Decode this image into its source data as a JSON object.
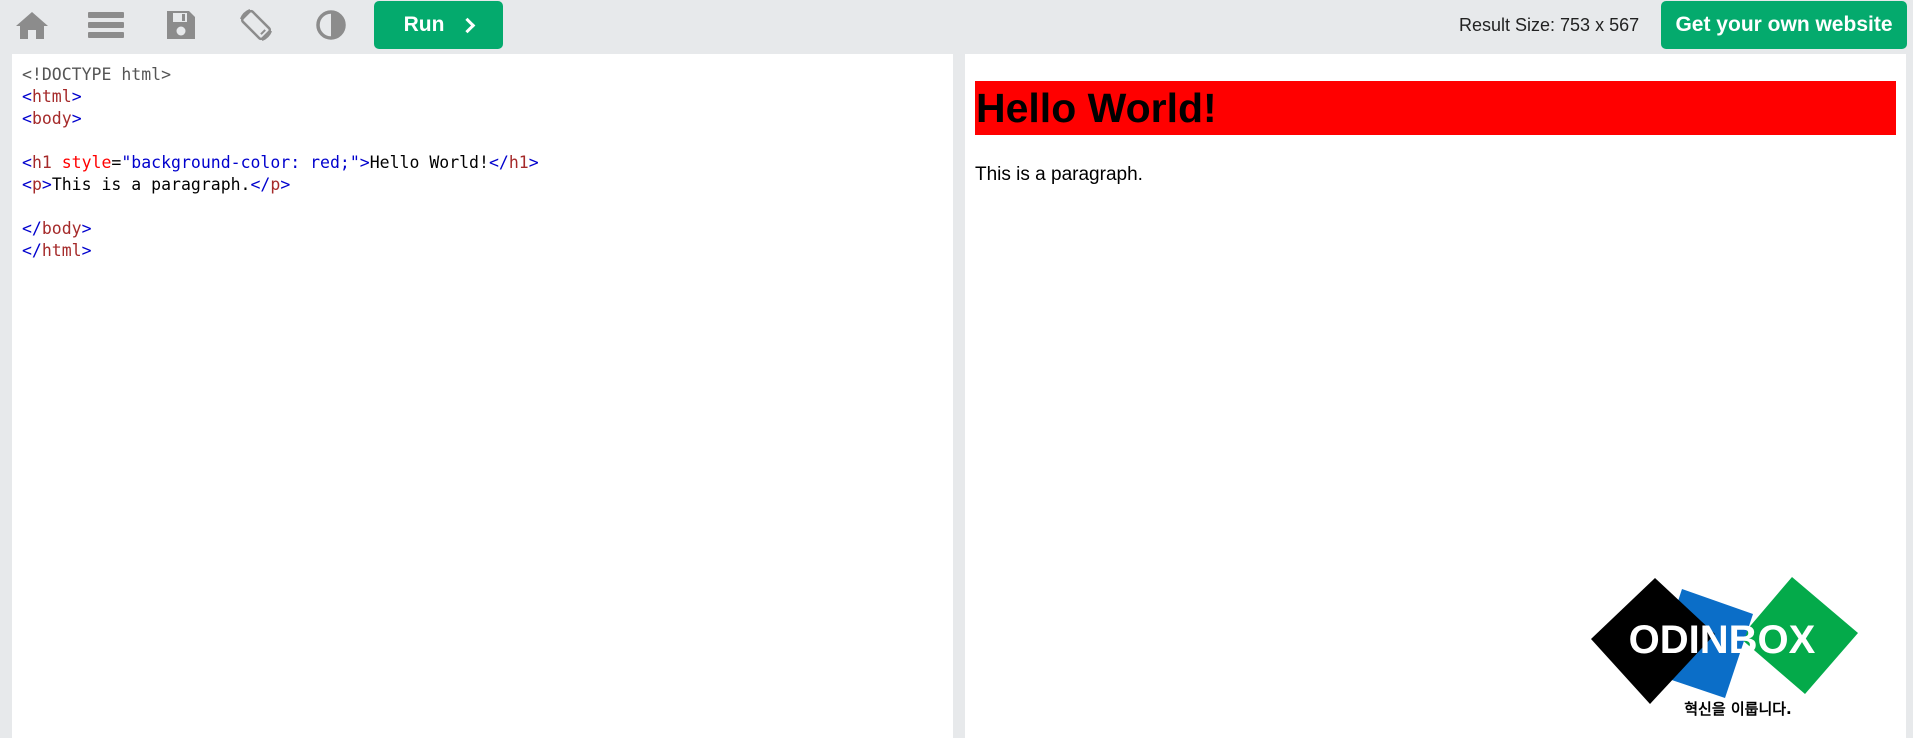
{
  "toolbar": {
    "icons": [
      "home-icon",
      "menu-icon",
      "save-icon",
      "rotate-icon",
      "contrast-icon"
    ],
    "run_label": "Run",
    "result_size": "Result Size: 753 x 567",
    "own_website_label": "Get your own website"
  },
  "colors": {
    "accent": "#04aa6d",
    "toolbar_bg": "#e7e9eb",
    "heading_bg": "#ff0000"
  },
  "editor": {
    "lines": [
      "<!DOCTYPE html>",
      "<html>",
      "<body>",
      "",
      "<h1 style=\"background-color: red;\">Hello World!</h1>",
      "<p>This is a paragraph.</p>",
      "",
      "</body>",
      "</html>"
    ]
  },
  "result": {
    "heading": "Hello World!",
    "paragraph": "This is a paragraph."
  },
  "logo": {
    "text": "ODINBOX",
    "tagline": "혁신을 이룹니다."
  }
}
